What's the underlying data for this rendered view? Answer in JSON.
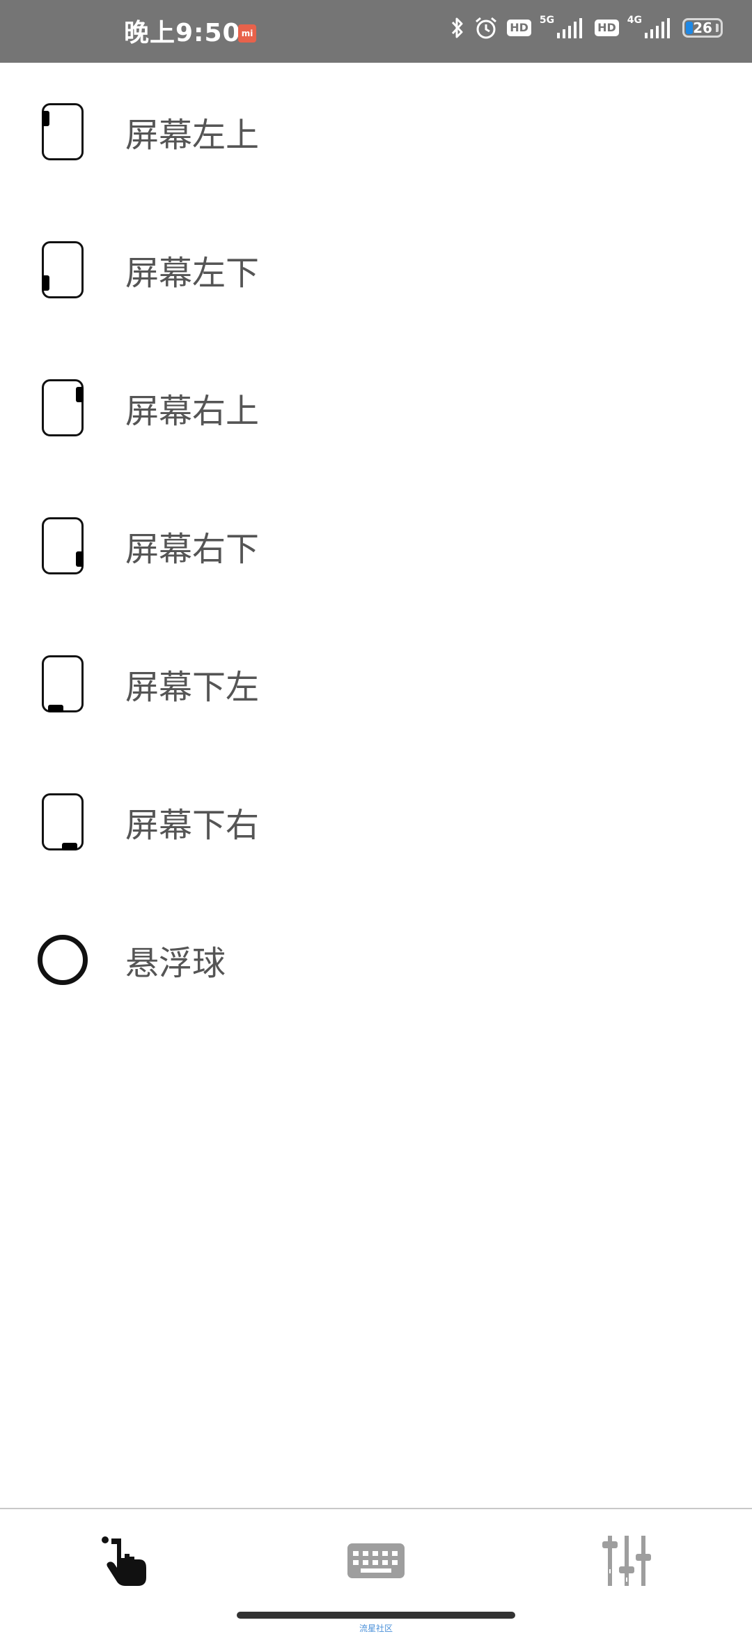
{
  "status_bar": {
    "time": "晚上9:50",
    "mi_badge": "mi",
    "hd1": "HD",
    "hd2": "HD",
    "net1": "5G",
    "net2": "4G",
    "battery": "26"
  },
  "options": [
    {
      "label": "屏幕左上"
    },
    {
      "label": "屏幕左下"
    },
    {
      "label": "屏幕右上"
    },
    {
      "label": "屏幕右下"
    },
    {
      "label": "屏幕下左"
    },
    {
      "label": "屏幕下右"
    },
    {
      "label": "悬浮球"
    }
  ],
  "bottom_nav": {
    "watermark": "流星社区"
  },
  "colors": {
    "status_bar_bg": "#757575",
    "label_text": "#555555",
    "icon": "#111111",
    "nav_icon": "#9e9e9e"
  }
}
